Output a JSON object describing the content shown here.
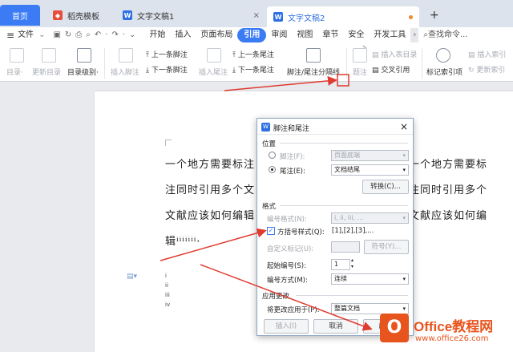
{
  "titlebar": {
    "home_tab": "首页",
    "tabs": [
      {
        "label": "稻壳模板",
        "icon": "docer-icon"
      },
      {
        "label": "文字文稿1",
        "icon": "writer-icon"
      },
      {
        "label": "文字文稿2",
        "icon": "writer-icon"
      }
    ],
    "new_tab": "+"
  },
  "menubar": {
    "file": "文件",
    "items": [
      "开始",
      "插入",
      "页面布局",
      "引用",
      "审阅",
      "视图",
      "章节",
      "安全",
      "开发工具"
    ],
    "active": "引用",
    "search": "查找命令..."
  },
  "ribbon": {
    "toc": "目录·",
    "update_toc": "更新目录",
    "toc_level": "目录级别·",
    "insert_footnote": "插入脚注",
    "prev_footnote": "上一条脚注",
    "next_footnote": "下一条脚注",
    "insert_endnote": "插入尾注",
    "prev_endnote": "上一条尾注",
    "next_endnote": "下一条尾注",
    "separator": "脚注/尾注分隔线",
    "caption": "题注",
    "insert_tof": "插入表目录",
    "cross_ref": "交叉引用",
    "mark_index": "标记索引项",
    "insert_index": "插入索引",
    "update_index": "更新索引"
  },
  "document": {
    "lines": [
      "一个地方需要标注",
      "注同时引用多个文",
      "文献应该如何编辑",
      "辑ⁱⁱⁱⁱⁱⁱⁱ·"
    ],
    "lines_right": [
      "一个地方需要标",
      "注同时引用多个",
      "文献应该如何编"
    ],
    "notes": [
      "i",
      "ii",
      "iii",
      "iv"
    ]
  },
  "dialog": {
    "title": "脚注和尾注",
    "position_label": "位置",
    "footnote_label": "脚注(F):",
    "footnote_value": "页面底端",
    "endnote_label": "尾注(E):",
    "endnote_value": "文档结尾",
    "convert_button": "转换(C)...",
    "format_label": "格式",
    "number_format_label": "编号格式(N):",
    "number_format_value": "i, ii, iii, ...",
    "bracket_label": "方括号样式(Q):",
    "bracket_value": "[1],[2],[3],...",
    "custom_mark_label": "自定义标记(U):",
    "symbol_button": "符号(Y)...",
    "start_label": "起始编号(S):",
    "start_value": "1",
    "numbering_label": "编号方式(M):",
    "numbering_value": "连续",
    "apply_changes_label": "应用更改",
    "apply_to_label": "将更改应用于(P):",
    "apply_to_value": "整篇文档",
    "insert_button": "插入(I)",
    "cancel_button": "取消",
    "apply_button": "应用"
  },
  "watermark": {
    "brand": "Office教程网",
    "url": "www.office26.com"
  },
  "colors": {
    "accent": "#3b7cf5",
    "arrow": "#e03b2f",
    "watermark": "#e8541e"
  }
}
